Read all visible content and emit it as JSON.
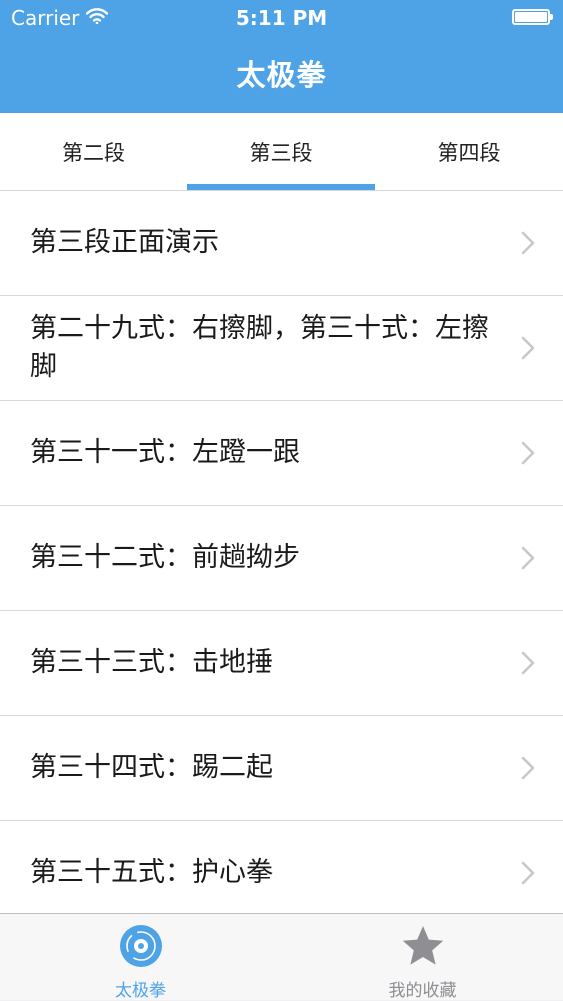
{
  "status_bar": {
    "carrier": "Carrier",
    "time": "5:11 PM"
  },
  "nav": {
    "title": "太极拳"
  },
  "segments": {
    "items": [
      {
        "label": "第二段",
        "selected": false
      },
      {
        "label": "第三段",
        "selected": true
      },
      {
        "label": "第四段",
        "selected": false
      }
    ]
  },
  "list": {
    "items": [
      {
        "label": "第三段正面演示"
      },
      {
        "label": "第二十九式：右擦脚，第三十式：左擦脚"
      },
      {
        "label": "第三十一式：左蹬一跟"
      },
      {
        "label": "第三十二式：前趟拗步"
      },
      {
        "label": "第三十三式：击地捶"
      },
      {
        "label": "第三十四式：踢二起"
      },
      {
        "label": "第三十五式：护心拳"
      }
    ]
  },
  "tabbar": {
    "items": [
      {
        "label": "太极拳",
        "icon": "disc-icon",
        "selected": true
      },
      {
        "label": "我的收藏",
        "icon": "star-icon",
        "selected": false
      }
    ]
  },
  "colors": {
    "accent": "#4da3e6",
    "inactive": "#8e8e93"
  }
}
